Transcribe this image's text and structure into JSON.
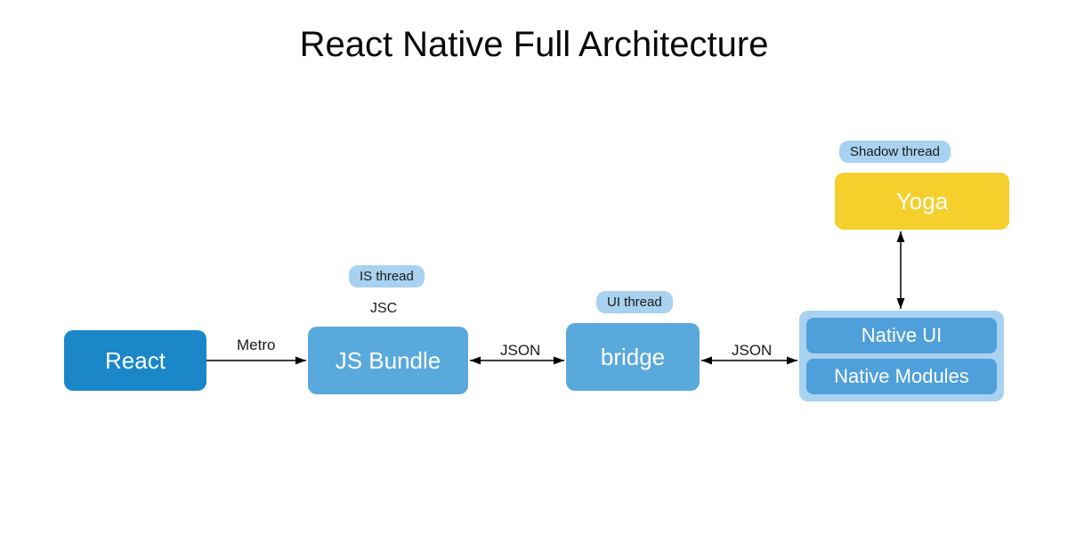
{
  "title": "React Native Full Architecture",
  "nodes": {
    "react": {
      "label": "React"
    },
    "jsbundle": {
      "label": "JS Bundle",
      "sublabel": "JSC",
      "thread_pill": "IS thread"
    },
    "bridge": {
      "label": "bridge",
      "thread_pill": "UI thread"
    },
    "yoga": {
      "label": "Yoga",
      "thread_pill": "Shadow thread"
    },
    "native_ui": {
      "label": "Native UI"
    },
    "native_mods": {
      "label": "Native Modules"
    }
  },
  "edges": {
    "react_to_jsbundle": {
      "label": "Metro"
    },
    "jsbundle_to_bridge": {
      "label": "JSON"
    },
    "bridge_to_native": {
      "label": "JSON"
    }
  },
  "colors": {
    "react_box": "#1a87c9",
    "mid_box": "#5aa9dd",
    "yoga_box": "#f5cf2c",
    "pill_bg": "#a8d2f0",
    "native_inner": "#4f9fdb"
  }
}
